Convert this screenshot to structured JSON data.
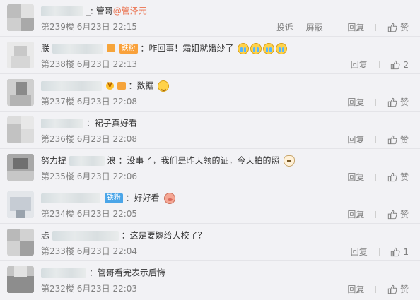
{
  "comments": [
    {
      "name_suffix": "_:",
      "text": "管哥",
      "mention": "@管泽元",
      "meta": "第239楼 6月23日 22:15",
      "actions": [
        "投诉",
        "屏蔽",
        "回复"
      ],
      "like": "赞"
    },
    {
      "name_prefix": "朕",
      "badge": "铁粉",
      "text": "：咋回事！霜姐就婚纱了",
      "emoji": [
        "cry-icon",
        "cry-icon",
        "cry-icon",
        "cry-icon"
      ],
      "meta": "第238楼 6月23日 22:13",
      "actions": [
        "回复"
      ],
      "like": "2"
    },
    {
      "verified": "V",
      "text": "：数据",
      "emoji": [
        "wink-icon"
      ],
      "meta": "第237楼 6月23日 22:08",
      "actions": [
        "回复"
      ],
      "like": "赞"
    },
    {
      "text": "：裙子真好看",
      "meta": "第236楼 6月23日 22:08",
      "actions": [
        "回复"
      ],
      "like": "赞"
    },
    {
      "name_prefix": "努力提",
      "name_suffix": "浪",
      "text": "：没事了，我们是昨天领的证，今天拍的照",
      "emoji": [
        "cat-icon"
      ],
      "meta": "第235楼 6月23日 22:06",
      "actions": [
        "回复"
      ],
      "like": "赞"
    },
    {
      "badge": "铁粉",
      "text": "：好好看",
      "emoji": [
        "pig-icon"
      ],
      "meta": "第234楼 6月23日 22:05",
      "actions": [
        "回复"
      ],
      "like": "赞"
    },
    {
      "name_prefix": "忐",
      "text": "：这是要嫁给大校了？",
      "meta": "第233楼 6月23日 22:04",
      "actions": [
        "回复"
      ],
      "like": "1"
    },
    {
      "text": "：管哥看完表示后悔",
      "meta": "第232楼 6月23日 22:03",
      "actions": [
        "回复"
      ],
      "like": "赞"
    }
  ]
}
